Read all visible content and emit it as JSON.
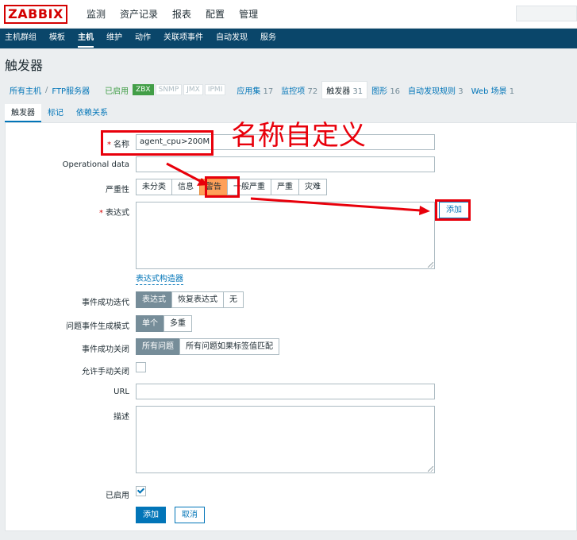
{
  "app": {
    "logo": "ZABBIX",
    "main_menu": [
      "监测",
      "资产记录",
      "报表",
      "配置",
      "管理"
    ],
    "sub_menu": [
      "主机群组",
      "模板",
      "主机",
      "维护",
      "动作",
      "关联项事件",
      "自动发现",
      "服务"
    ],
    "page_title": "触发器"
  },
  "breadcrumb": {
    "all_hosts": "所有主机",
    "separator": "/",
    "host": "FTP服务器",
    "enabled": "已启用",
    "badges": [
      "ZBX",
      "SNMP",
      "JMX",
      "IPMI"
    ],
    "links": [
      {
        "label": "应用集",
        "count": "17"
      },
      {
        "label": "监控项",
        "count": "72"
      },
      {
        "label": "触发器",
        "count": "31"
      },
      {
        "label": "图形",
        "count": "16"
      },
      {
        "label": "自动发现规则",
        "count": "3"
      },
      {
        "label": "Web 场景",
        "count": "1"
      }
    ]
  },
  "tabs": [
    "触发器",
    "标记",
    "依赖关系"
  ],
  "form": {
    "name_label": "名称",
    "name_value": "agent_cpu>200M",
    "opdata_label": "Operational data",
    "opdata_value": "",
    "severity_label": "严重性",
    "severity_options": [
      "未分类",
      "信息",
      "警告",
      "一般严重",
      "严重",
      "灾难"
    ],
    "severity_selected": "警告",
    "expression_label": "表达式",
    "expression_value": "",
    "add_label": "添加",
    "expression_builder": "表达式构造器",
    "ok_event_label": "事件成功迭代",
    "ok_event_options": [
      "表达式",
      "恢复表达式",
      "无"
    ],
    "problem_mode_label": "问题事件生成模式",
    "problem_mode_options": [
      "单个",
      "多重"
    ],
    "ok_close_label": "事件成功关闭",
    "ok_close_options": [
      "所有问题",
      "所有问题如果标签值匹配"
    ],
    "manual_close_label": "允许手动关闭",
    "url_label": "URL",
    "url_value": "",
    "desc_label": "描述",
    "desc_value": "",
    "enabled_label": "已启用",
    "submit_label": "添加",
    "cancel_label": "取消"
  },
  "annotation": {
    "text": "名称自定义",
    "color": "#e8000b"
  },
  "colors": {
    "accent": "#0275b8",
    "submenu_bg": "#0a466a",
    "warning": "#ffa059",
    "enabled_green": "#429e47"
  }
}
